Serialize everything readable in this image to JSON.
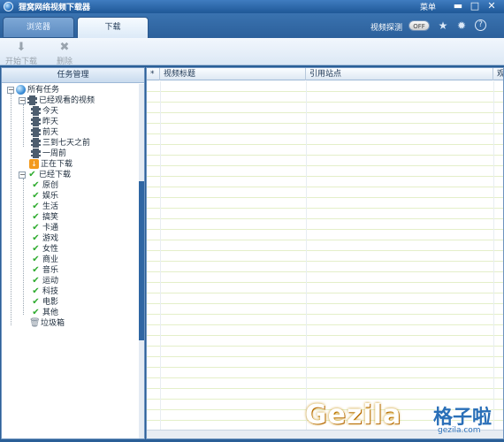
{
  "window": {
    "title": "狸窝网络视频下载器",
    "menu_label": "菜单"
  },
  "tabs": [
    {
      "label": "浏览器"
    },
    {
      "label": "下载"
    }
  ],
  "header_right": {
    "video_detect_label": "视频探测",
    "toggle_state": "OFF"
  },
  "actions": {
    "start": "开始下载",
    "delete": "删除"
  },
  "task_panel": {
    "title": "任务管理",
    "root": "所有任务",
    "watched": {
      "label": "已经观看的视频",
      "children": [
        "今天",
        "昨天",
        "前天",
        "三到七天之前",
        "一周前"
      ]
    },
    "downloading": "正在下载",
    "downloaded": {
      "label": "已经下载",
      "children": [
        "原创",
        "娱乐",
        "生活",
        "搞笑",
        "卡通",
        "游戏",
        "女性",
        "商业",
        "音乐",
        "运动",
        "科技",
        "电影",
        "其他"
      ]
    },
    "trash": "垃圾箱"
  },
  "table": {
    "columns": [
      "*",
      "视频标题",
      "引用站点",
      "观"
    ]
  },
  "watermark": {
    "text": "Gezila",
    "cn": "格子啦",
    "url": "gezila.com"
  },
  "colors": {
    "title_bar": "#1f5897",
    "accent": "#2b5f97",
    "row_stripe": "#e4efc9"
  }
}
